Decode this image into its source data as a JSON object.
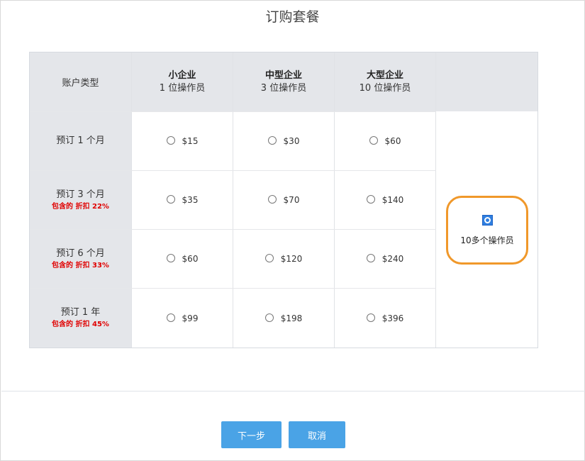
{
  "dialog": {
    "title": "订购套餐"
  },
  "table": {
    "account_type_label": "账户类型",
    "plans": [
      {
        "name": "小企业",
        "operators": "1 位操作员"
      },
      {
        "name": "中型企业",
        "operators": "3 位操作员"
      },
      {
        "name": "大型企业",
        "operators": "10 位操作员"
      }
    ],
    "rows": [
      {
        "label": "预订 1 个月",
        "discount": "",
        "prices": [
          "$15",
          "$30",
          "$60"
        ]
      },
      {
        "label": "预订 3 个月",
        "discount": "包含的 折扣 22%",
        "prices": [
          "$35",
          "$70",
          "$140"
        ]
      },
      {
        "label": "预订 6 个月",
        "discount": "包含的 折扣 33%",
        "prices": [
          "$60",
          "$120",
          "$240"
        ]
      },
      {
        "label": "预订 1 年",
        "discount": "包含的 折扣 45%",
        "prices": [
          "$99",
          "$198",
          "$396"
        ]
      }
    ],
    "enterprise": {
      "label": "10多个操作员",
      "selected": true
    }
  },
  "buttons": {
    "next": "下一步",
    "cancel": "取消"
  },
  "colors": {
    "highlight": "#f0982a",
    "button": "#4aa3e6",
    "discount": "#e00000"
  }
}
